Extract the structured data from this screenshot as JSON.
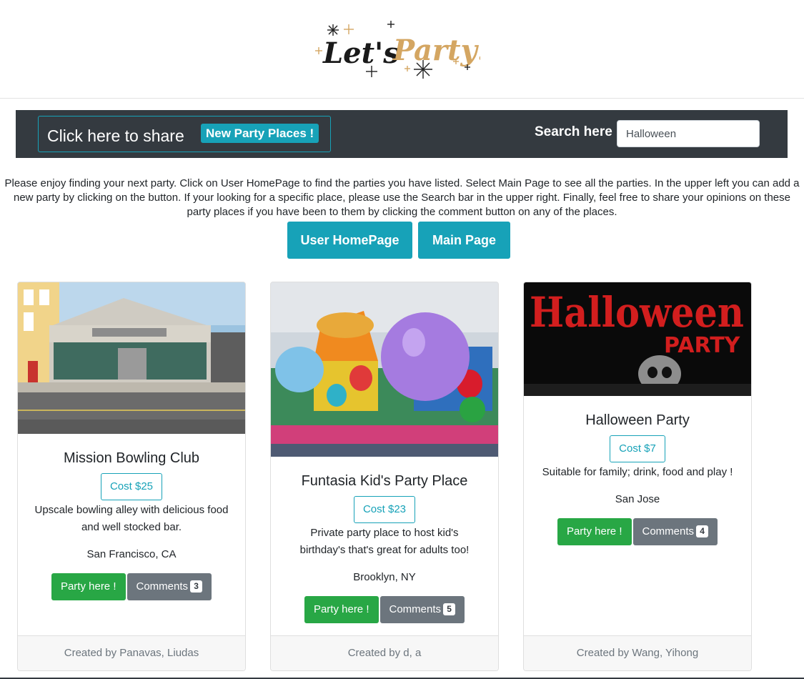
{
  "logo": {
    "part1": "Let's",
    "part2": "Party!"
  },
  "navbar": {
    "share_text": "Click here to share",
    "share_badge": "New Party Places !",
    "search_label": "Search here",
    "search_value": "Halloween"
  },
  "intro": "Please enjoy finding your next party. Click on User HomePage to find the parties you have listed. Select Main Page to see all the parties. In the upper left you can add a new party by clicking on the button. If your looking for a specific place, please use the Search bar in the upper right. Finally, feel free to share your opinions on these party places if you have been to them by clicking the comment button on any of the places.",
  "buttons": {
    "user_home": "User HomePage",
    "main_page": "Main Page"
  },
  "cards": [
    {
      "title": "Mission Bowling Club",
      "cost": "Cost $25",
      "description": "Upscale bowling alley with delicious food and well stocked bar.",
      "location": "San Francisco, CA",
      "party_button": "Party here !",
      "comments_button": "Comments",
      "comment_count": "3",
      "footer": "Created by Panavas, Liudas"
    },
    {
      "title": "Funtasia Kid's Party Place",
      "cost": "Cost $23",
      "description": "Private party place to host kid's birthday's that's great for adults too!",
      "location": "Brooklyn, NY",
      "party_button": "Party here !",
      "comments_button": "Comments",
      "comment_count": "5",
      "footer": "Created by d, a"
    },
    {
      "title": "Halloween Party",
      "cost": "Cost $7",
      "description": "Suitable for family; drink, food and play !",
      "location": "San Jose",
      "party_button": "Party here !",
      "comments_button": "Comments",
      "comment_count": "4",
      "footer": "Created by Wang, Yihong",
      "image_text_1": "Halloween",
      "image_text_2": "PARTY"
    }
  ],
  "colors": {
    "navbar": "#343a40",
    "info": "#17a2b8",
    "success": "#28a745",
    "secondary": "#6c757d",
    "logo_gold": "#d4a662"
  }
}
